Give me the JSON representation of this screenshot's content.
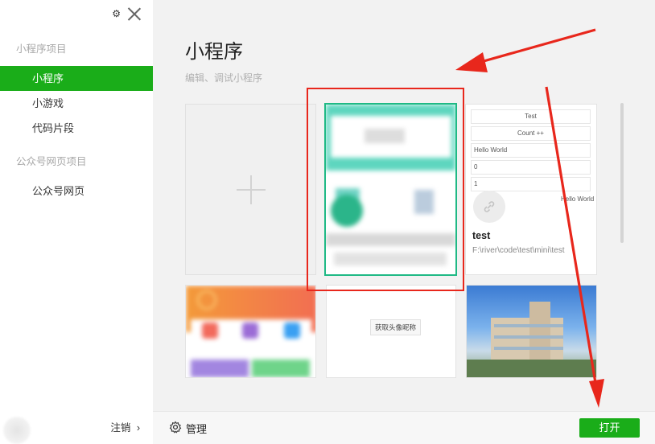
{
  "sidebar": {
    "group_miniprogram": "小程序项目",
    "items": [
      {
        "label": "小程序"
      },
      {
        "label": "小游戏"
      },
      {
        "label": "代码片段"
      }
    ],
    "group_official": "公众号网页项目",
    "official_item": "公众号网页",
    "logout_label": "注销",
    "logout_arrow": "›"
  },
  "main": {
    "title": "小程序",
    "subtitle": "编辑、调试小程序"
  },
  "test_card": {
    "preview_rows": [
      "Test",
      "Count ++",
      "Hello World",
      "0",
      "1"
    ],
    "hello_overlay": "Hello World",
    "name": "test",
    "path": "F:\\river\\code\\test\\mini\\test"
  },
  "card_get_avatar": {
    "button_label": "获取头像昵称"
  },
  "bottom": {
    "manage_label": "管理",
    "open_label": "打开"
  },
  "colors": {
    "accent": "#1aad19",
    "annotation": "#e8271c",
    "selected_border": "#1fb985"
  },
  "icons": [
    "gear-icon",
    "close-icon",
    "plus-icon",
    "link-icon",
    "chevron-right-icon"
  ]
}
